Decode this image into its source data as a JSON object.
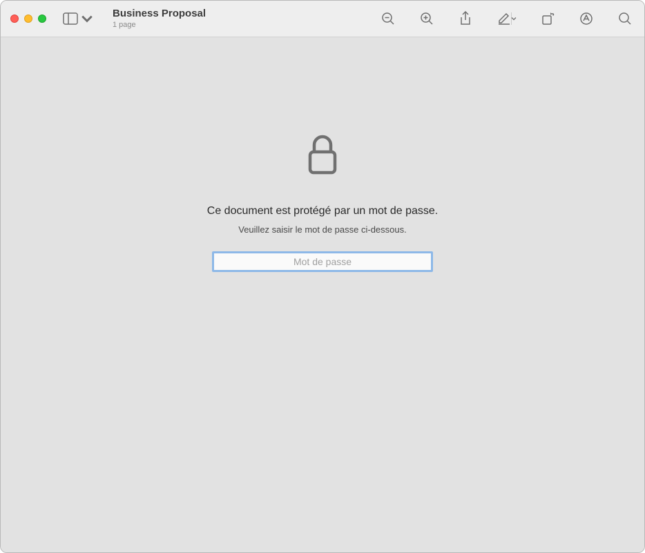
{
  "header": {
    "title": "Business Proposal",
    "subtitle": "1 page"
  },
  "content": {
    "protected_message": "Ce document est protégé par un mot de passe.",
    "instruction": "Veuillez saisir le mot de passe ci-dessous.",
    "password_placeholder": "Mot de passe"
  }
}
